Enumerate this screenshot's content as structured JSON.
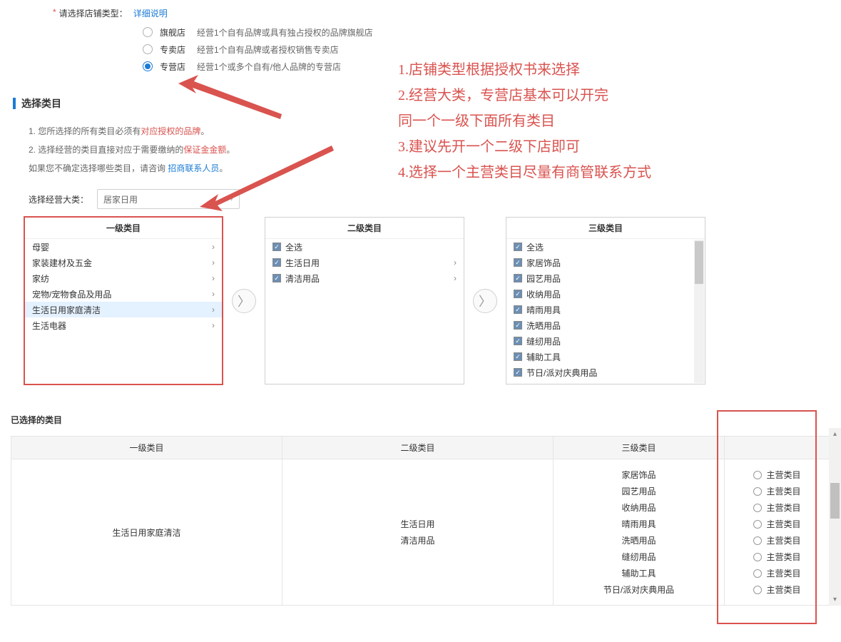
{
  "form": {
    "field_label": "请选择店铺类型：",
    "detail_link": "详细说明",
    "options": [
      {
        "label": "旗舰店",
        "desc": "经营1个自有品牌或具有独占授权的品牌旗舰店"
      },
      {
        "label": "专卖店",
        "desc": "经营1个自有品牌或者授权销售专卖店"
      },
      {
        "label": "专营店",
        "desc": "经营1个或多个自有/他人品牌的专营店"
      }
    ]
  },
  "section": {
    "title": "选择类目",
    "notes_line1_a": "1. 您所选择的所有类目必须有",
    "notes_line1_em": "对应授权的品牌",
    "notes_line1_b": "。",
    "notes_line2_a": "2. 选择经营的类目直接对应于需要缴纳的",
    "notes_line2_em": "保证金金额",
    "notes_line2_b": "。",
    "notes_line3_a": "如果您不确定选择哪些类目，请咨询 ",
    "notes_line3_link": "招商联系人员",
    "notes_line3_b": "。",
    "select_label": "选择经营大类：",
    "select_value": "居家日用"
  },
  "panels": {
    "h1": "一级类目",
    "h2": "二级类目",
    "h3": "三级类目",
    "level1": [
      "母婴",
      "家装建材及五金",
      "家纺",
      "宠物/宠物食品及用品",
      "生活日用家庭清洁",
      "生活电器"
    ],
    "level1_active_index": 4,
    "level2_all": "全选",
    "level2": [
      "生活日用",
      "清洁用品"
    ],
    "level3_all": "全选",
    "level3": [
      "家居饰品",
      "园艺用品",
      "收纳用品",
      "晴雨用具",
      "洗晒用品",
      "缝纫用品",
      "辅助工具",
      "节日/派对庆典用品"
    ]
  },
  "annotations": {
    "l1": "1.店铺类型根据授权书来选择",
    "l2": "2.经营大类，专营店基本可以开完",
    "l3": "同一个一级下面所有类目",
    "l4": "3.建议先开一个二级下店即可",
    "l5": "4.选择一个主营类目尽量有商管联系方式"
  },
  "selected": {
    "title": "已选择的类目",
    "cols": [
      "一级类目",
      "二级类目",
      "三级类目",
      ""
    ],
    "row": {
      "c1": "生活日用家庭清洁",
      "c2": [
        "生活日用",
        "清洁用品"
      ],
      "c3": [
        "家居饰品",
        "园艺用品",
        "收纳用品",
        "晴雨用具",
        "洗晒用品",
        "缝纫用品",
        "辅助工具",
        "节日/派对庆典用品"
      ],
      "c4_label": "主营类目"
    }
  }
}
